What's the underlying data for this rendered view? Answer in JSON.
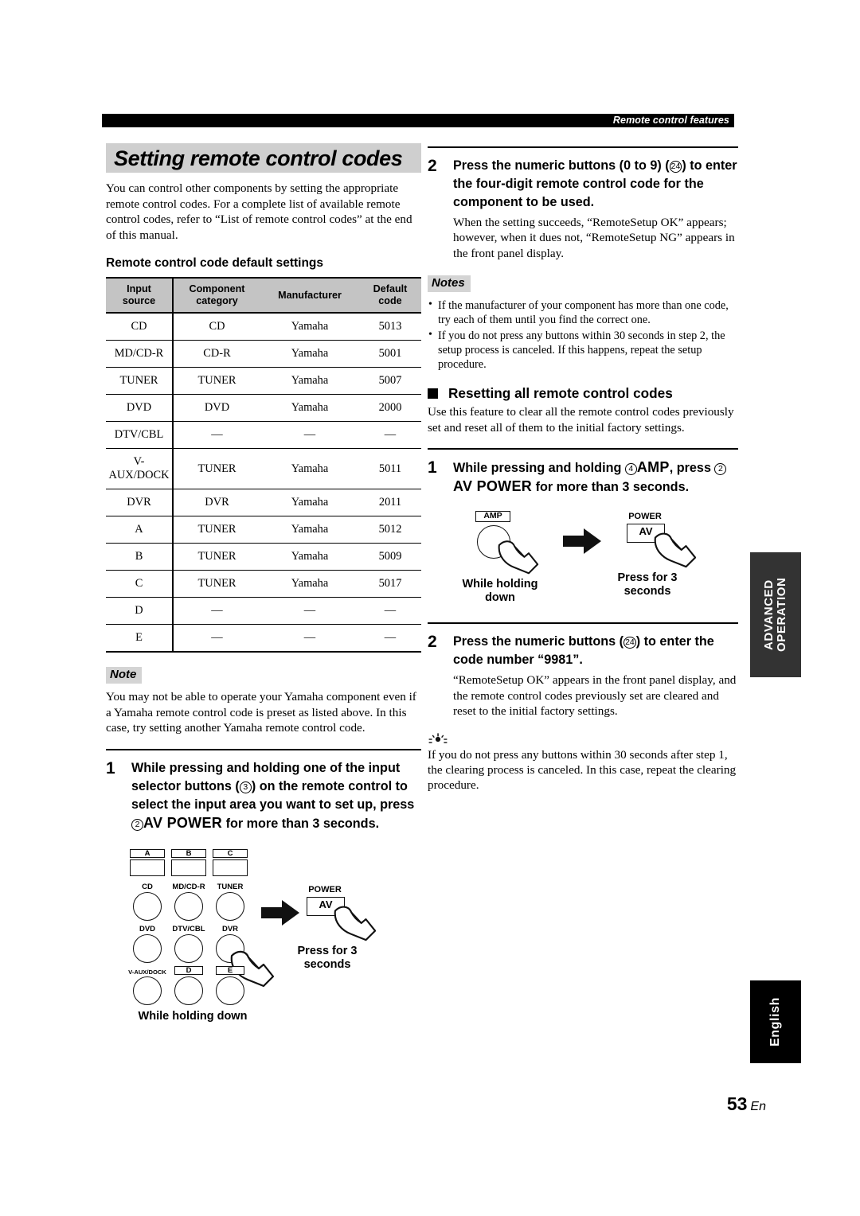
{
  "running_header": {
    "text": "Remote control features"
  },
  "page_number": {
    "number": "53",
    "language_suffix": "En"
  },
  "side_tabs": {
    "advanced": "ADVANCED OPERATION",
    "language": "English"
  },
  "left_column": {
    "title": "Setting remote control codes",
    "intro": "You can control other components by setting the appropriate remote control codes. For a complete list of available remote control codes, refer to “List of remote control codes” at the end of this manual.",
    "table_heading": "Remote control code default settings",
    "table": {
      "headers": [
        "Input source",
        "Component category",
        "Manufacturer",
        "Default code"
      ],
      "header_lines": [
        [
          "Input",
          "source"
        ],
        [
          "Component",
          "category"
        ],
        [
          "Manufacturer"
        ],
        [
          "Default",
          "code"
        ]
      ],
      "rows": [
        {
          "source": "CD",
          "category": "CD",
          "manufacturer": "Yamaha",
          "code": "5013"
        },
        {
          "source": "MD/CD-R",
          "category": "CD-R",
          "manufacturer": "Yamaha",
          "code": "5001"
        },
        {
          "source": "TUNER",
          "category": "TUNER",
          "manufacturer": "Yamaha",
          "code": "5007"
        },
        {
          "source": "DVD",
          "category": "DVD",
          "manufacturer": "Yamaha",
          "code": "2000"
        },
        {
          "source": "DTV/CBL",
          "category": "—",
          "manufacturer": "—",
          "code": "—"
        },
        {
          "source": "V-AUX/DOCK",
          "category": "TUNER",
          "manufacturer": "Yamaha",
          "code": "5011"
        },
        {
          "source": "DVR",
          "category": "DVR",
          "manufacturer": "Yamaha",
          "code": "2011"
        },
        {
          "source": "A",
          "category": "TUNER",
          "manufacturer": "Yamaha",
          "code": "5012"
        },
        {
          "source": "B",
          "category": "TUNER",
          "manufacturer": "Yamaha",
          "code": "5009"
        },
        {
          "source": "C",
          "category": "TUNER",
          "manufacturer": "Yamaha",
          "code": "5017"
        },
        {
          "source": "D",
          "category": "—",
          "manufacturer": "—",
          "code": "—"
        },
        {
          "source": "E",
          "category": "—",
          "manufacturer": "—",
          "code": "—"
        }
      ]
    },
    "note": {
      "tag": "Note",
      "text": "You may not be able to operate your Yamaha component even if a Yamaha remote control code is preset as listed above. In this case, try setting another Yamaha remote control code."
    },
    "step1": {
      "number": "1",
      "text_part1": "While pressing and holding one of the input selector buttons (",
      "circled1": "3",
      "text_part2": ") on the remote control to select the input area you want to set up, press ",
      "circled2": "2",
      "bold_label": "AV POWER",
      "text_part3": " for more than 3 seconds."
    },
    "diagram": {
      "top_buttons": [
        "A",
        "B",
        "C"
      ],
      "grid_labels": [
        [
          "CD",
          "MD/CD-R",
          "TUNER"
        ],
        [
          "DVD",
          "DTV/CBL",
          "DVR"
        ],
        [
          "V-AUX/DOCK",
          "D",
          "E"
        ]
      ],
      "caption_left": "While holding down",
      "power_group_label": "POWER",
      "power_button_label": "AV",
      "caption_right_line1": "Press for 3",
      "caption_right_line2": "seconds"
    }
  },
  "right_column": {
    "step2": {
      "number": "2",
      "head_part1": "Press the numeric buttons (0 to 9) (",
      "circled": "24",
      "head_part2": ") to enter the four-digit remote control code for the component to be used.",
      "detail": "When the setting succeeds, “RemoteSetup OK” appears; however, when it dues not, “RemoteSetup NG” appears in the front panel display."
    },
    "notes": {
      "tag": "Notes",
      "items": [
        "If the manufacturer of your component has more than one code, try each of them until you find the correct one.",
        "If you do not press any buttons within 30 seconds in step 2, the setup process is canceled. If this happens, repeat the setup procedure."
      ]
    },
    "section": {
      "heading": "Resetting all remote control codes",
      "intro": "Use this feature to clear all the remote control codes previously set and reset all of them to the initial factory settings."
    },
    "step1": {
      "number": "1",
      "head_part1": "While pressing and holding ",
      "circled1": "4",
      "bold1": "AMP",
      "head_part2": ", press ",
      "circled2": "2",
      "bold2": "AV POWER",
      "head_part3": " for more than 3 seconds."
    },
    "diagram": {
      "amp_label": "AMP",
      "caption_left_line1": "While holding",
      "caption_left_line2": "down",
      "power_group_label": "POWER",
      "power_button_label": "AV",
      "caption_right_line1": "Press for 3",
      "caption_right_line2": "seconds"
    },
    "step2b": {
      "number": "2",
      "head_part1": "Press the numeric buttons (",
      "circled": "24",
      "head_part2": ") to enter the code number “9981”.",
      "detail": "“RemoteSetup OK” appears in the front panel display, and the remote control codes previously set are cleared and reset to the initial factory settings."
    },
    "tip": {
      "text": "If you do not press any buttons within 30 seconds after step 1, the clearing process is canceled. In this case, repeat the clearing procedure."
    }
  }
}
